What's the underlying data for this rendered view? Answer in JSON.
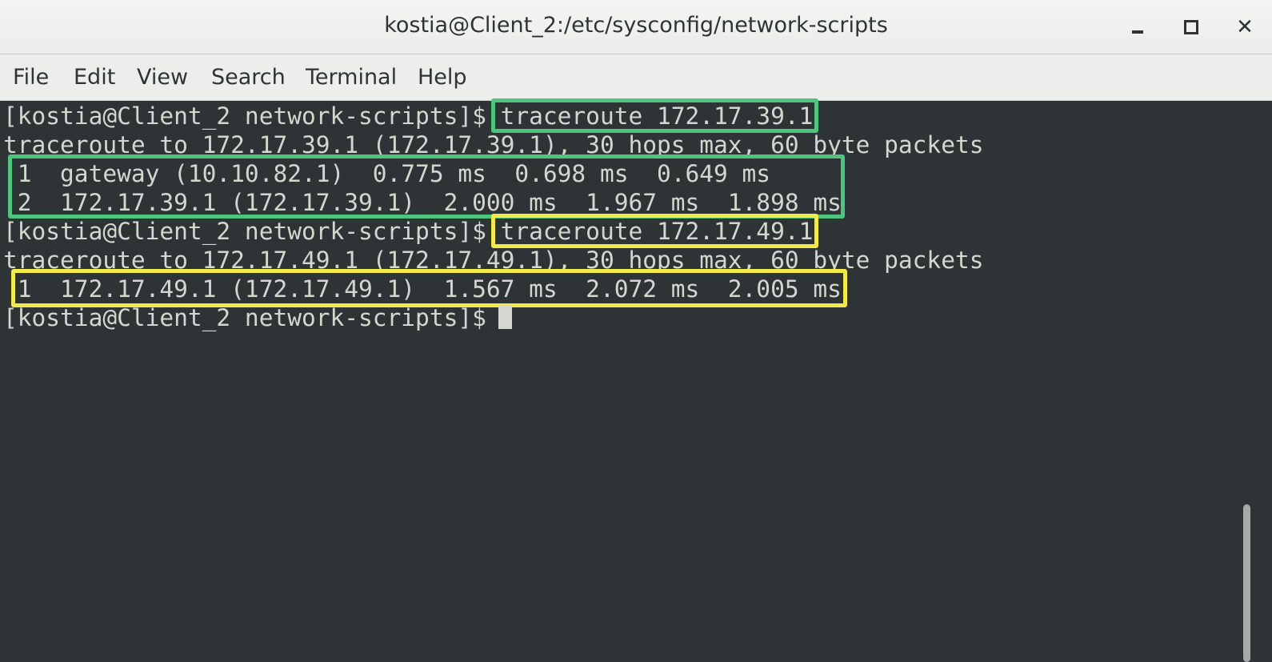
{
  "window": {
    "title": "kostia@Client_2:/etc/sysconfig/network-scripts",
    "controls": {
      "minimize_icon": "minimize-icon",
      "maximize_icon": "maximize-icon",
      "close_icon": "close-icon",
      "close_glyph": "✕"
    }
  },
  "menubar": {
    "items": [
      "File",
      "Edit",
      "View",
      "Search",
      "Terminal",
      "Help"
    ]
  },
  "terminal": {
    "lines": [
      "[kostia@Client_2 network-scripts]$ traceroute 172.17.39.1",
      "traceroute to 172.17.39.1 (172.17.39.1), 30 hops max, 60 byte packets",
      " 1  gateway (10.10.82.1)  0.775 ms  0.698 ms  0.649 ms",
      " 2  172.17.39.1 (172.17.39.1)  2.000 ms  1.967 ms  1.898 ms",
      "[kostia@Client_2 network-scripts]$ traceroute 172.17.49.1",
      "traceroute to 172.17.49.1 (172.17.49.1), 30 hops max, 60 byte packets",
      " 1  172.17.49.1 (172.17.49.1)  1.567 ms  2.072 ms  2.005 ms",
      "[kostia@Client_2 network-scripts]$ "
    ]
  },
  "colors": {
    "terminal_bg": "#2e3436",
    "terminal_fg": "#d3d7cf",
    "highlight_green": "#4ec57c",
    "highlight_yellow": "#f2e94a"
  }
}
